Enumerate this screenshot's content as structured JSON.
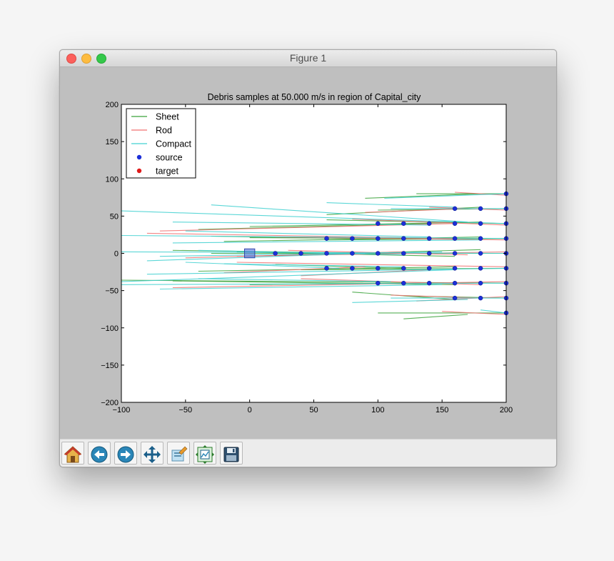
{
  "window": {
    "title": "Figure 1"
  },
  "chart_data": {
    "type": "line",
    "title": "Debris samples at 50.000 m/s in region of Capital_city",
    "xlabel": "",
    "ylabel": "",
    "xlim": [
      -100,
      200
    ],
    "ylim": [
      -200,
      200
    ],
    "xticks": [
      -100,
      -50,
      0,
      50,
      100,
      150,
      200
    ],
    "yticks": [
      -200,
      -150,
      -100,
      -50,
      0,
      50,
      100,
      150,
      200
    ],
    "xtick_labels": [
      "−100",
      "−50",
      "0",
      "50",
      "100",
      "150",
      "200"
    ],
    "ytick_labels": [
      "−200",
      "−150",
      "−100",
      "−50",
      "0",
      "50",
      "100",
      "150",
      "200"
    ],
    "grid": false,
    "legend_position": "top-left",
    "legend": [
      {
        "label": "Sheet",
        "kind": "line",
        "color": "#3aa23a"
      },
      {
        "label": "Rod",
        "kind": "line",
        "color": "#f07070"
      },
      {
        "label": "Compact",
        "kind": "line",
        "color": "#40d0d0"
      },
      {
        "label": "source",
        "kind": "marker",
        "color": "#1c2fd8"
      },
      {
        "label": "target",
        "kind": "marker",
        "color": "#e01a1a"
      }
    ],
    "target_area": {
      "x": [
        -4,
        4
      ],
      "y": [
        -6,
        6
      ],
      "color": "#5577dd"
    },
    "source_points": [
      [
        20,
        0
      ],
      [
        40,
        0
      ],
      [
        60,
        0
      ],
      [
        80,
        0
      ],
      [
        100,
        0
      ],
      [
        120,
        0
      ],
      [
        140,
        0
      ],
      [
        160,
        0
      ],
      [
        180,
        0
      ],
      [
        200,
        0
      ],
      [
        60,
        20
      ],
      [
        80,
        20
      ],
      [
        100,
        20
      ],
      [
        120,
        20
      ],
      [
        140,
        20
      ],
      [
        160,
        20
      ],
      [
        180,
        20
      ],
      [
        200,
        20
      ],
      [
        60,
        -20
      ],
      [
        80,
        -20
      ],
      [
        100,
        -20
      ],
      [
        120,
        -20
      ],
      [
        140,
        -20
      ],
      [
        160,
        -20
      ],
      [
        180,
        -20
      ],
      [
        200,
        -20
      ],
      [
        100,
        40
      ],
      [
        120,
        40
      ],
      [
        140,
        40
      ],
      [
        160,
        40
      ],
      [
        180,
        40
      ],
      [
        200,
        40
      ],
      [
        100,
        -40
      ],
      [
        120,
        -40
      ],
      [
        140,
        -40
      ],
      [
        160,
        -40
      ],
      [
        180,
        -40
      ],
      [
        200,
        -40
      ],
      [
        160,
        60
      ],
      [
        180,
        60
      ],
      [
        200,
        60
      ],
      [
        160,
        -60
      ],
      [
        180,
        -60
      ],
      [
        200,
        -60
      ],
      [
        200,
        80
      ],
      [
        200,
        -80
      ]
    ],
    "series": [
      {
        "kind": "Sheet",
        "segments": [
          [
            [
              200,
              0
            ],
            [
              -30,
              0
            ]
          ],
          [
            [
              180,
              5
            ],
            [
              20,
              -3
            ]
          ],
          [
            [
              160,
              -4
            ],
            [
              -10,
              2
            ]
          ],
          [
            [
              200,
              20
            ],
            [
              60,
              18
            ]
          ],
          [
            [
              180,
              22
            ],
            [
              -20,
              16
            ]
          ],
          [
            [
              140,
              20
            ],
            [
              0,
              21
            ]
          ],
          [
            [
              200,
              -20
            ],
            [
              40,
              -22
            ]
          ],
          [
            [
              160,
              -18
            ],
            [
              -40,
              -24
            ]
          ],
          [
            [
              120,
              -20
            ],
            [
              20,
              -15
            ]
          ],
          [
            [
              200,
              40
            ],
            [
              60,
              45
            ]
          ],
          [
            [
              180,
              42
            ],
            [
              0,
              36
            ]
          ],
          [
            [
              140,
              40
            ],
            [
              -40,
              32
            ]
          ],
          [
            [
              200,
              -40
            ],
            [
              -100,
              -36
            ]
          ],
          [
            [
              160,
              -42
            ],
            [
              -60,
              -37
            ]
          ],
          [
            [
              120,
              -40
            ],
            [
              0,
              -42
            ]
          ],
          [
            [
              200,
              60
            ],
            [
              100,
              58
            ]
          ],
          [
            [
              180,
              62
            ],
            [
              60,
              52
            ]
          ],
          [
            [
              200,
              -60
            ],
            [
              120,
              -57
            ]
          ],
          [
            [
              160,
              -62
            ],
            [
              80,
              -52
            ]
          ],
          [
            [
              200,
              80
            ],
            [
              130,
              80
            ]
          ],
          [
            [
              180,
              80
            ],
            [
              90,
              74
            ]
          ],
          [
            [
              200,
              -80
            ],
            [
              100,
              -80
            ]
          ],
          [
            [
              170,
              -82
            ],
            [
              120,
              -88
            ]
          ],
          [
            [
              100,
              0
            ],
            [
              -60,
              4
            ]
          ],
          [
            [
              80,
              20
            ],
            [
              -30,
              23
            ]
          ]
        ]
      },
      {
        "kind": "Rod",
        "segments": [
          [
            [
              200,
              2
            ],
            [
              -10,
              -4
            ]
          ],
          [
            [
              170,
              -2
            ],
            [
              30,
              4
            ]
          ],
          [
            [
              200,
              18
            ],
            [
              20,
              22
            ]
          ],
          [
            [
              160,
              20
            ],
            [
              -80,
              27
            ]
          ],
          [
            [
              200,
              -18
            ],
            [
              -10,
              -12
            ]
          ],
          [
            [
              140,
              -22
            ],
            [
              40,
              -30
            ]
          ],
          [
            [
              200,
              38
            ],
            [
              80,
              46
            ]
          ],
          [
            [
              160,
              40
            ],
            [
              -70,
              30
            ]
          ],
          [
            [
              200,
              -38
            ],
            [
              -60,
              -46
            ]
          ],
          [
            [
              180,
              -42
            ],
            [
              40,
              -34
            ]
          ],
          [
            [
              200,
              58
            ],
            [
              140,
              62
            ]
          ],
          [
            [
              170,
              60
            ],
            [
              90,
              55
            ]
          ],
          [
            [
              200,
              -58
            ],
            [
              130,
              -64
            ]
          ],
          [
            [
              180,
              -60
            ],
            [
              110,
              -56
            ]
          ],
          [
            [
              200,
              78
            ],
            [
              160,
              82
            ]
          ],
          [
            [
              200,
              -82
            ],
            [
              150,
              -78
            ]
          ],
          [
            [
              120,
              2
            ],
            [
              -50,
              -6
            ]
          ],
          [
            [
              90,
              -18
            ],
            [
              -20,
              -26
            ]
          ]
        ]
      },
      {
        "kind": "Compact",
        "segments": [
          [
            [
              200,
              0
            ],
            [
              -100,
              2
            ]
          ],
          [
            [
              150,
              2
            ],
            [
              -70,
              -4
            ]
          ],
          [
            [
              120,
              -2
            ],
            [
              -40,
              4
            ]
          ],
          [
            [
              200,
              20
            ],
            [
              -100,
              24
            ]
          ],
          [
            [
              180,
              18
            ],
            [
              -60,
              14
            ]
          ],
          [
            [
              140,
              22
            ],
            [
              -50,
              30
            ]
          ],
          [
            [
              200,
              -20
            ],
            [
              -80,
              -28
            ]
          ],
          [
            [
              160,
              -22
            ],
            [
              -100,
              -38
            ]
          ],
          [
            [
              120,
              -18
            ],
            [
              -20,
              -14
            ]
          ],
          [
            [
              200,
              40
            ],
            [
              -100,
              57
            ]
          ],
          [
            [
              170,
              42
            ],
            [
              -30,
              65
            ]
          ],
          [
            [
              140,
              38
            ],
            [
              -60,
              42
            ]
          ],
          [
            [
              200,
              -40
            ],
            [
              -100,
              -42
            ]
          ],
          [
            [
              150,
              -42
            ],
            [
              -70,
              -48
            ]
          ],
          [
            [
              110,
              -38
            ],
            [
              -40,
              -34
            ]
          ],
          [
            [
              200,
              60
            ],
            [
              110,
              60
            ]
          ],
          [
            [
              160,
              62
            ],
            [
              60,
              68
            ]
          ],
          [
            [
              200,
              -60
            ],
            [
              110,
              -60
            ]
          ],
          [
            [
              170,
              -62
            ],
            [
              80,
              -66
            ]
          ],
          [
            [
              200,
              80
            ],
            [
              105,
              74
            ]
          ],
          [
            [
              200,
              -80
            ],
            [
              180,
              -76
            ]
          ],
          [
            [
              90,
              0
            ],
            [
              -80,
              -10
            ]
          ],
          [
            [
              70,
              -20
            ],
            [
              -50,
              -12
            ]
          ]
        ]
      }
    ]
  },
  "toolbar": {
    "buttons": [
      {
        "name": "home-button",
        "icon": "home-icon"
      },
      {
        "name": "back-button",
        "icon": "back-arrow-icon"
      },
      {
        "name": "forward-button",
        "icon": "forward-arrow-icon"
      },
      {
        "name": "pan-button",
        "icon": "move-arrows-icon"
      },
      {
        "name": "zoom-button",
        "icon": "zoom-rect-icon"
      },
      {
        "name": "subplots-button",
        "icon": "subplots-icon"
      },
      {
        "name": "save-button",
        "icon": "floppy-disk-icon"
      }
    ]
  }
}
